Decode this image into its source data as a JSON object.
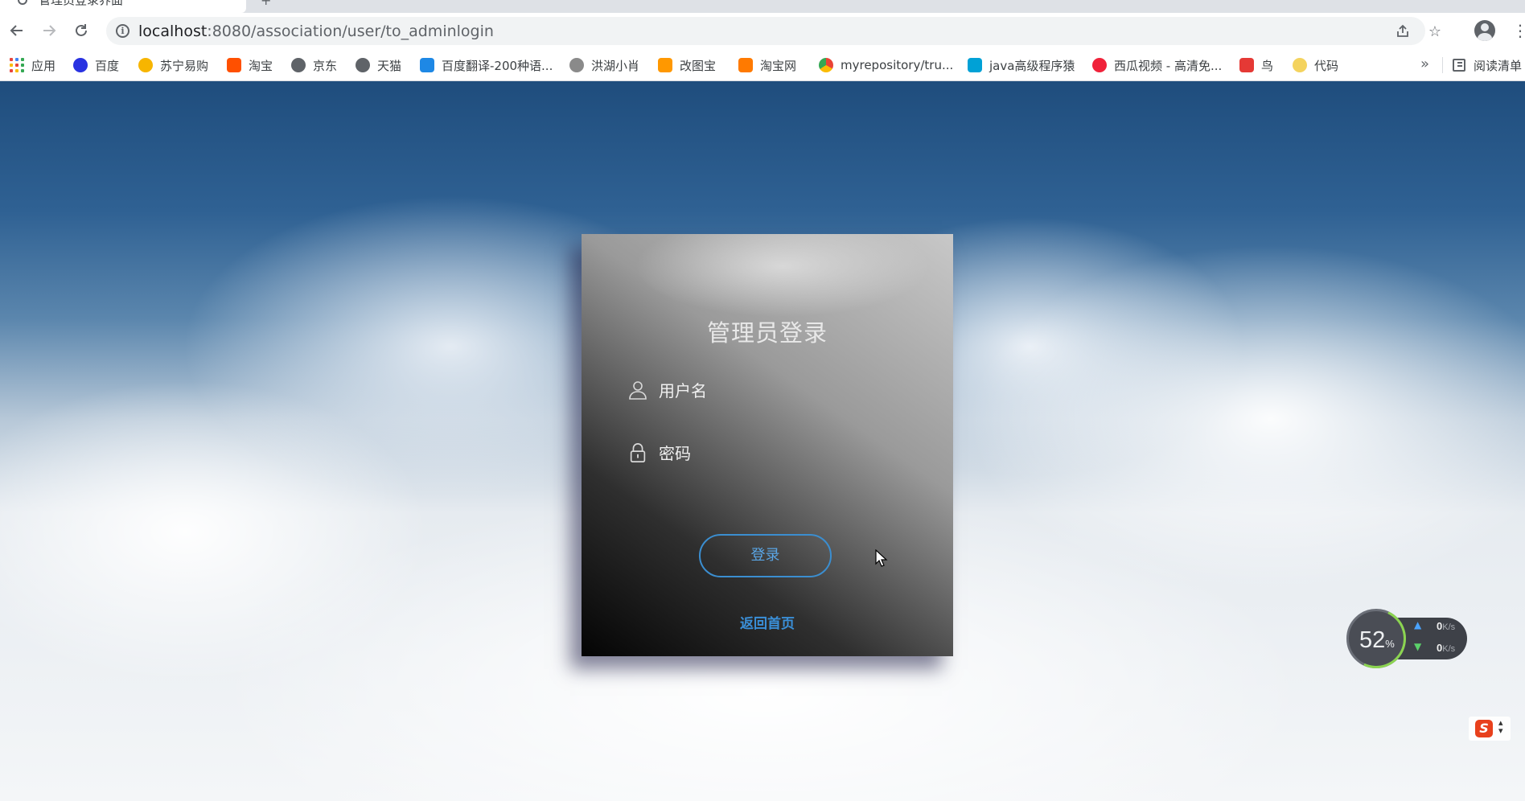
{
  "browser": {
    "tab": {
      "title": "管理员登录界面",
      "icon": "globe-icon",
      "new_tab_icon": "plus-icon"
    },
    "nav": {
      "back_icon": "arrow-left-icon",
      "forward_icon": "arrow-right-icon",
      "reload_icon": "reload-icon"
    },
    "url": {
      "host": "localhost",
      "path": ":8080/association/user/to_adminlogin",
      "info_icon": "info-icon"
    },
    "omnibox_actions": [
      "share-icon",
      "star-icon"
    ],
    "bookmarks": [
      {
        "label": "应用",
        "icon": "apps-grid-icon",
        "color": "#4285f4"
      },
      {
        "label": "百度",
        "icon": "baidu-paw-icon",
        "color": "#2932e1"
      },
      {
        "label": "苏宁易购",
        "icon": "suning-icon",
        "color": "#f7b500"
      },
      {
        "label": "淘宝",
        "icon": "taobao-icon",
        "color": "#ff5000"
      },
      {
        "label": "京东",
        "icon": "globe-icon",
        "color": "#5f6368"
      },
      {
        "label": "天猫",
        "icon": "globe-icon",
        "color": "#5f6368"
      },
      {
        "label": "百度翻译-200种语...",
        "icon": "translate-icon",
        "color": "#1e88e5"
      },
      {
        "label": "洪湖小肖",
        "icon": "bird-icon",
        "color": "#8a8a8a"
      },
      {
        "label": "改图宝",
        "icon": "gaitubao-icon",
        "color": "#ff9800"
      },
      {
        "label": "淘宝网",
        "icon": "taobao-icon",
        "color": "#ff7a00"
      },
      {
        "label": "myrepository/tru...",
        "icon": "chrome-icon",
        "color": "#34a853"
      },
      {
        "label": "java高级程序猿",
        "icon": "bilibili-icon",
        "color": "#00a1d6"
      },
      {
        "label": "西瓜视频 - 高清免...",
        "icon": "xigua-icon",
        "color": "#f0223a"
      },
      {
        "label": "鸟",
        "icon": "bird-icon",
        "color": "#e53935"
      },
      {
        "label": "代码",
        "icon": "moon-icon",
        "color": "#f4d35e"
      }
    ],
    "bookmarks_overflow": "»",
    "reading_list": "阅读清单"
  },
  "login": {
    "title": "管理员登录",
    "username_placeholder": "用户名",
    "password_placeholder": "密码",
    "submit_label": "登录",
    "back_link": "返回首页",
    "accent_color": "#3b8ed0"
  },
  "speed_widget": {
    "percent": "52",
    "percent_unit": "%",
    "upload": "0",
    "download": "0",
    "rate_unit": "K/s"
  },
  "ime": {
    "label": "S"
  }
}
